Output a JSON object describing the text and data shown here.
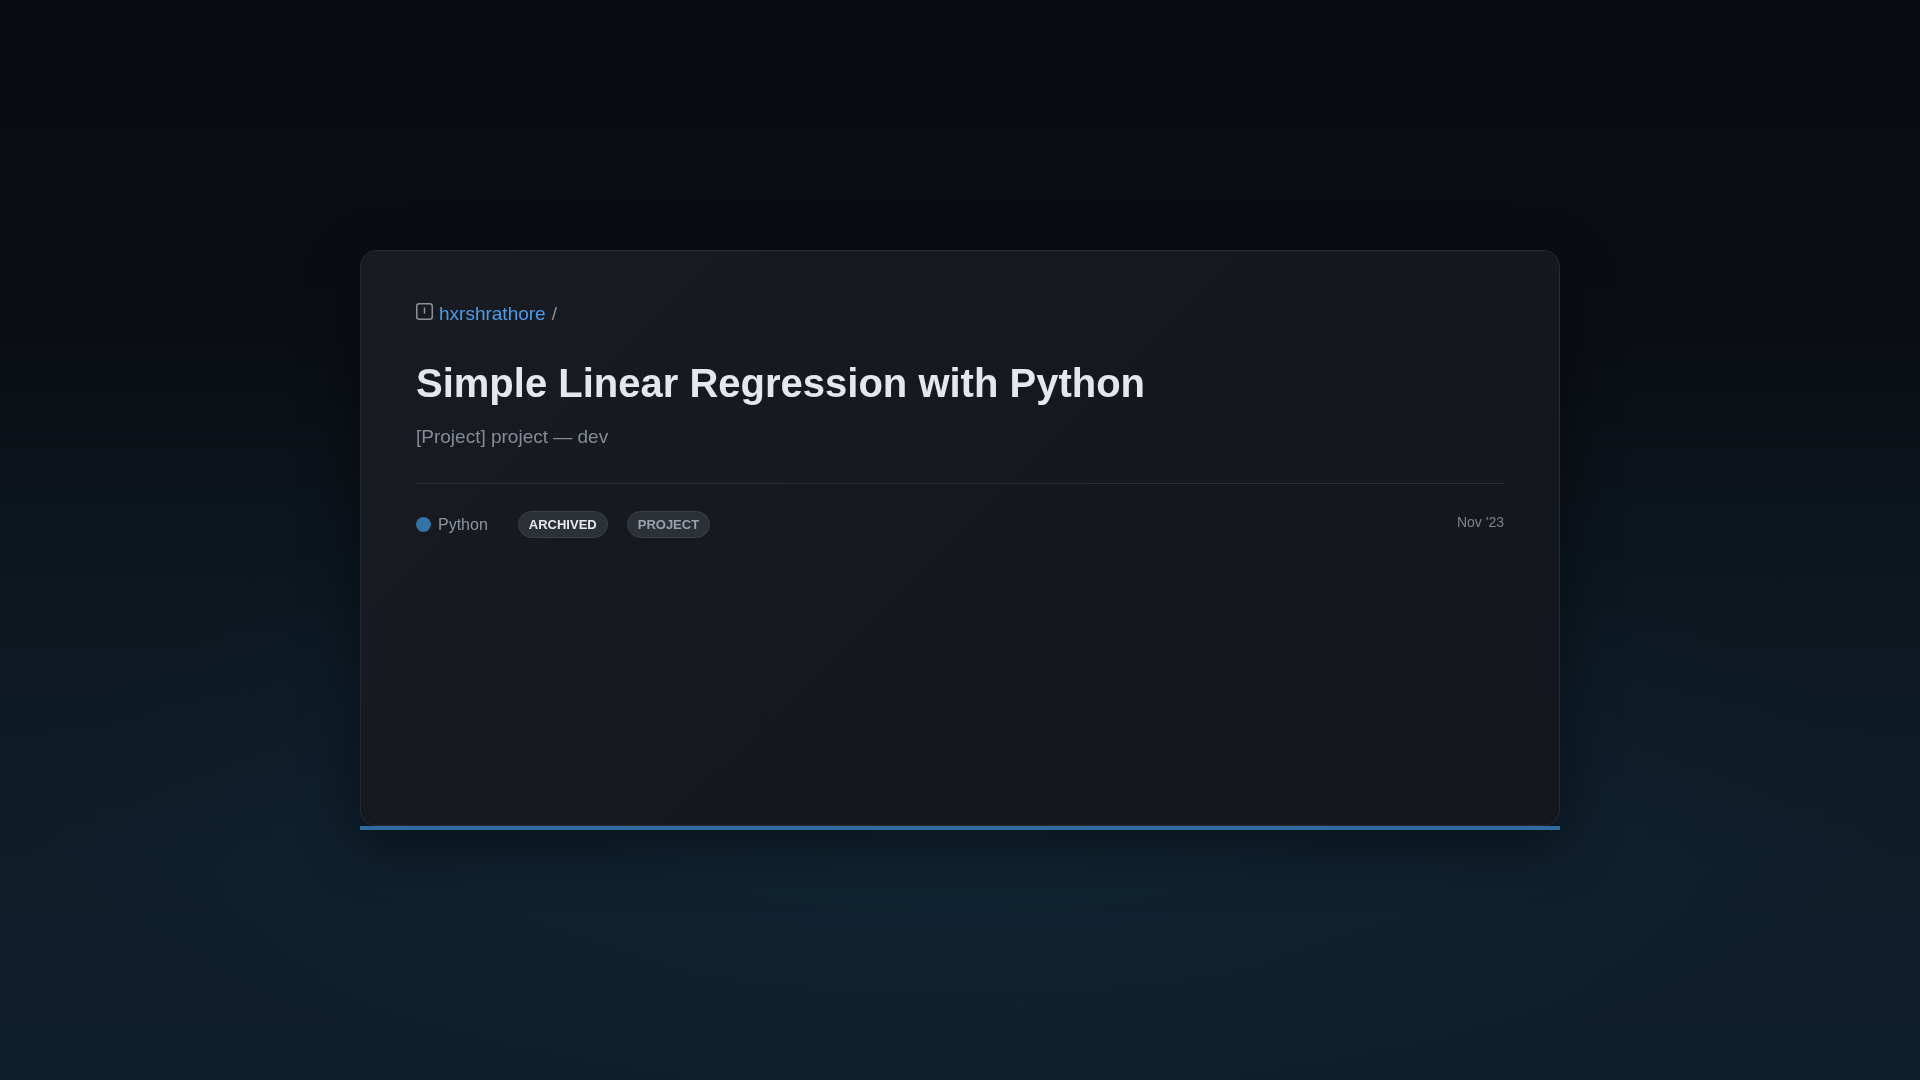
{
  "card": {
    "breadcrumb": {
      "owner": "hxrshrathore",
      "separator": "/"
    },
    "title": "Simple Linear Regression with Python",
    "subtitle": "[Project] project — dev",
    "language": {
      "name": "Python",
      "color": "#3572a5"
    },
    "tags": [
      {
        "label": "ARCHIVED",
        "kind": "status"
      },
      {
        "label": "PROJECT",
        "kind": "category"
      }
    ],
    "date": "Nov '23"
  }
}
